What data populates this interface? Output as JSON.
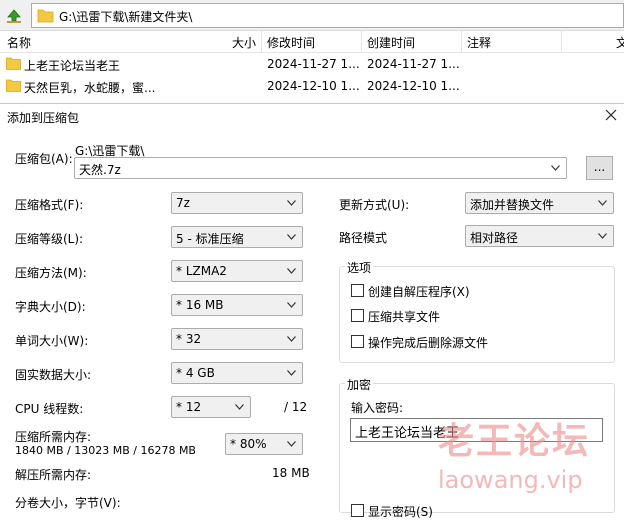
{
  "file_manager": {
    "address": "G:\\迅雷下载\\新建文件夹\\",
    "columns": [
      "名称",
      "大小",
      "修改时间",
      "创建时间",
      "注释",
      "文"
    ],
    "files": [
      {
        "name": "上老王论坛当老王",
        "modified": "2024-11-27 1...",
        "created": "2024-11-27 1..."
      },
      {
        "name": "天然巨乳，水蛇腰，蜜...",
        "modified": "2024-12-10 1...",
        "created": "2024-12-10 1..."
      }
    ]
  },
  "dialog": {
    "title": "添加到压缩包",
    "archive": {
      "label": "压缩包(A):",
      "path": "G:\\迅雷下载\\",
      "name": "天然.7z",
      "browse": "..."
    },
    "left_fields": [
      {
        "label": "压缩格式(F):",
        "value": "7z"
      },
      {
        "label": "压缩等级(L):",
        "value": "5 - 标准压缩"
      },
      {
        "label": "压缩方法(M):",
        "value": "*  LZMA2"
      },
      {
        "label": "字典大小(D):",
        "value": "*  16 MB"
      },
      {
        "label": "单词大小(W):",
        "value": "*  32"
      },
      {
        "label": "固实数据大小:",
        "value": "*  4 GB"
      },
      {
        "label": "CPU 线程数:",
        "value": "*  12",
        "suffix": "/ 12"
      }
    ],
    "memory": {
      "label": "压缩所需内存:",
      "detail": "1840 MB / 13023 MB / 16278 MB",
      "value": "*  80%"
    },
    "decompress": {
      "label": "解压所需内存:",
      "value": "18 MB"
    },
    "split": {
      "label": "分卷大小，字节(V):"
    },
    "update_mode": {
      "label": "更新方式(U):",
      "value": "添加并替换文件"
    },
    "path_mode": {
      "label": "路径模式",
      "value": "相对路径"
    },
    "options": {
      "title": "选项",
      "items": [
        "创建自解压程序(X)",
        "压缩共享文件",
        "操作完成后删除源文件"
      ]
    },
    "encryption": {
      "title": "加密",
      "password_label": "输入密码:",
      "password_value": "上老王论坛当老王",
      "show_password_label": "显示密码(S)"
    }
  },
  "watermark": {
    "cn": "老王论坛",
    "en": "laowang.vip"
  },
  "colors": {
    "folder": "#f5c842",
    "up_arrow": "#3a9a2a",
    "watermark": "#ec8c8c"
  }
}
